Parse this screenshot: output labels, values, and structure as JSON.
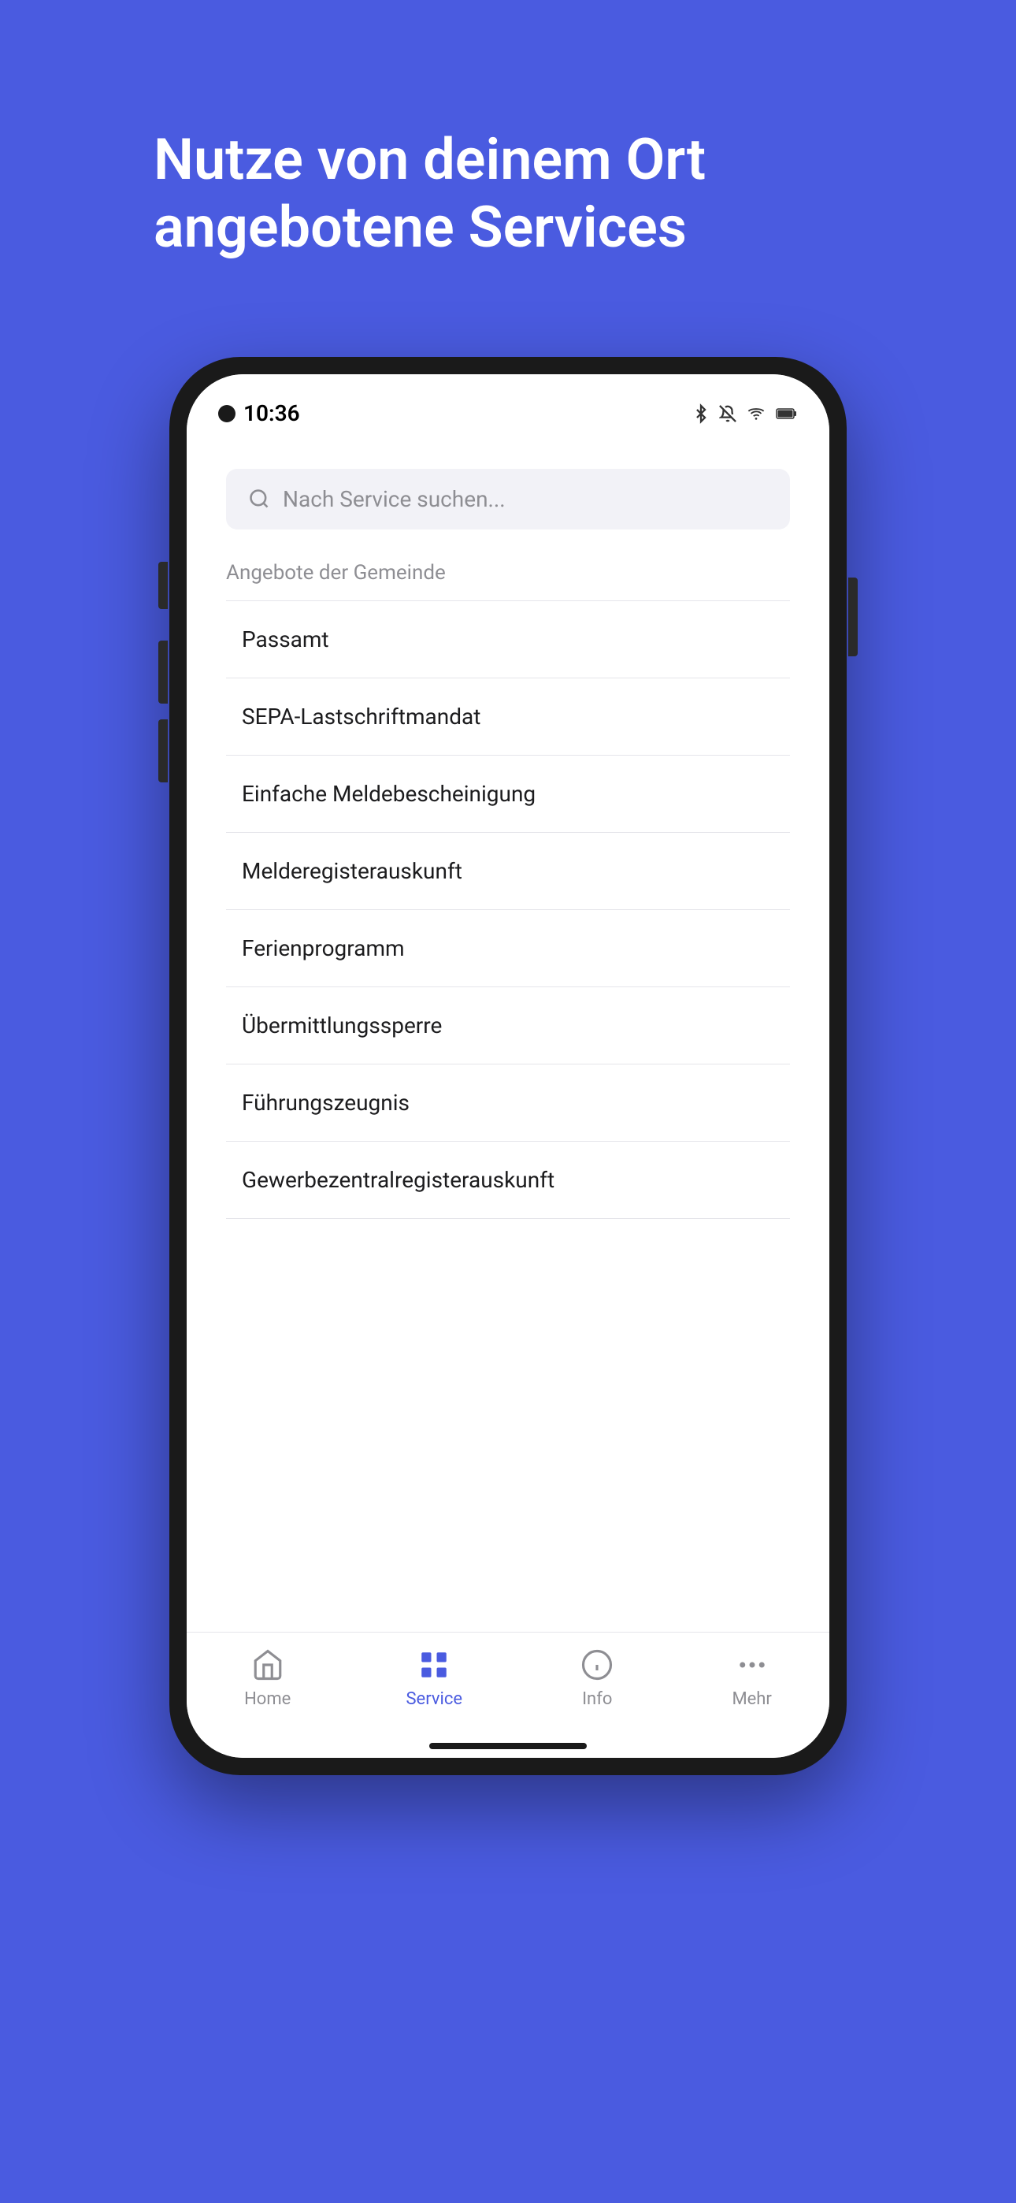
{
  "background": {
    "color": "#4A5BE0"
  },
  "headline": {
    "line1": "Nutze von deinem Ort",
    "line2": "angebotene Services",
    "full": "Nutze von deinem Ort angebotene Services"
  },
  "phone": {
    "statusBar": {
      "time": "10:36",
      "icons": [
        "bluetooth",
        "bell-off",
        "wifi",
        "battery"
      ]
    },
    "search": {
      "placeholder": "Nach Service suchen..."
    },
    "sectionLabel": "Angebote der Gemeinde",
    "services": [
      {
        "name": "Passamt"
      },
      {
        "name": "SEPA-Lastschriftmandat"
      },
      {
        "name": "Einfache Meldebescheinigung"
      },
      {
        "name": "Melderegisterauskunft"
      },
      {
        "name": "Ferienprogramm"
      },
      {
        "name": "Übermittlungssperre"
      },
      {
        "name": "Führungszeugnis"
      },
      {
        "name": "Gewerbezentralregisterauskunft"
      }
    ],
    "bottomNav": [
      {
        "id": "home",
        "label": "Home",
        "active": false
      },
      {
        "id": "service",
        "label": "Service",
        "active": true
      },
      {
        "id": "info",
        "label": "Info",
        "active": false
      },
      {
        "id": "mehr",
        "label": "Mehr",
        "active": false
      }
    ]
  }
}
